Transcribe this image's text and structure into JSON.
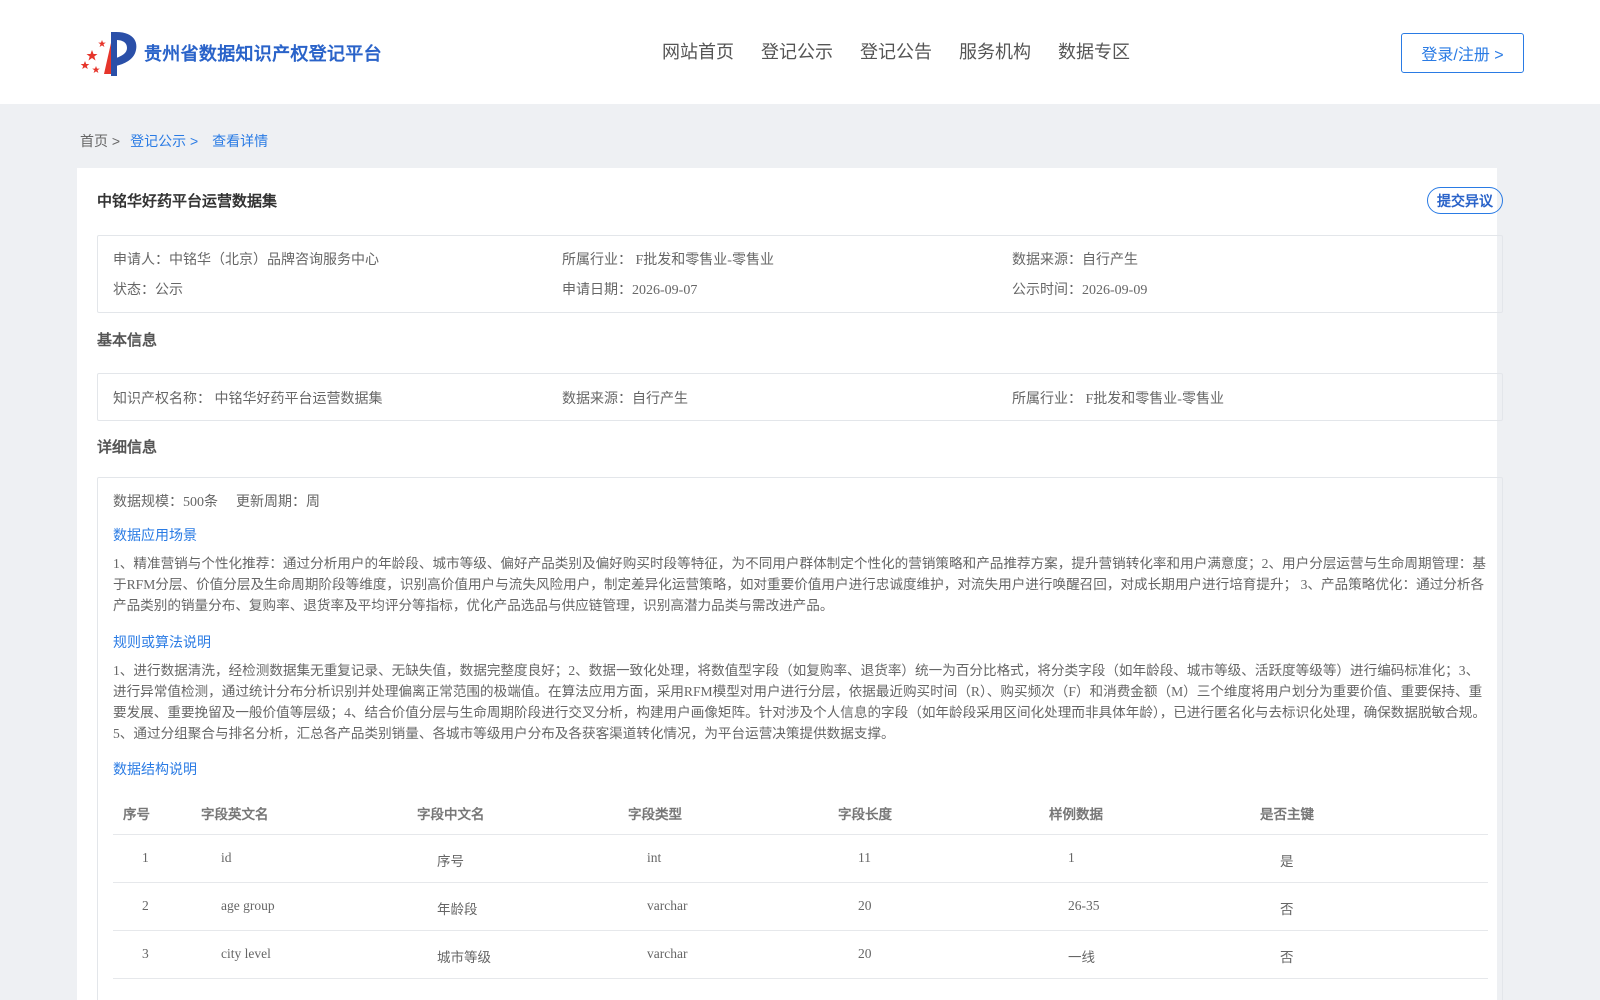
{
  "header": {
    "site_title": "贵州省数据知识产权登记平台",
    "nav": [
      "网站首页",
      "登记公示",
      "登记公告",
      "服务机构",
      "数据专区"
    ],
    "login_label": "登录/注册 >"
  },
  "breadcrumb": {
    "home": "首页 >",
    "section": "登记公示 >",
    "current": "查看详情"
  },
  "detail": {
    "title": "中铭华好药平台运营数据集",
    "objection_label": "提交异议",
    "summary": {
      "applicant": "申请人：中铭华（北京）品牌咨询服务中心",
      "industry": "所属行业： F批发和零售业-零售业",
      "source": "数据来源：自行产生",
      "status": "状态：公示",
      "apply_date": "申请日期：2026-09-07",
      "publish_date": "公示时间：2026-09-09"
    },
    "basic_info_title": "基本信息",
    "basic": {
      "ip_name": "知识产权名称： 中铭华好药平台运营数据集",
      "source": "数据来源：自行产生",
      "industry": "所属行业： F批发和零售业-零售业"
    },
    "detail_info_title": "详细信息",
    "scale": "数据规模：500条",
    "update_cycle": "更新周期：周",
    "scenario_title": "数据应用场景",
    "scenario_text": "1、精准营销与个性化推荐：通过分析用户的年龄段、城市等级、偏好产品类别及偏好购买时段等特征，为不同用户群体制定个性化的营销策略和产品推荐方案，提升营销转化率和用户满意度；2、用户分层运营与生命周期管理：基于RFM分层、价值分层及生命周期阶段等维度，识别高价值用户与流失风险用户，制定差异化运营策略，如对重要价值用户进行忠诚度维护，对流失用户进行唤醒召回，对成长期用户进行培育提升； 3、产品策略优化：通过分析各产品类别的销量分布、复购率、退货率及平均评分等指标，优化产品选品与供应链管理，识别高潜力品类与需改进产品。",
    "rules_title": "规则或算法说明",
    "rules_text": "1、进行数据清洗，经检测数据集无重复记录、无缺失值，数据完整度良好；2、数据一致化处理，将数值型字段（如复购率、退货率）统一为百分比格式，将分类字段（如年龄段、城市等级、活跃度等级等）进行编码标准化；3、进行异常值检测，通过统计分布分析识别并处理偏离正常范围的极端值。在算法应用方面，采用RFM模型对用户进行分层，依据最近购买时间（R）、购买频次（F）和消费金额（M）三个维度将用户划分为重要价值、重要保持、重要发展、重要挽留及一般价值等层级；4、结合价值分层与生命周期阶段进行交叉分析，构建用户画像矩阵。针对涉及个人信息的字段（如年龄段采用区间化处理而非具体年龄），已进行匿名化与去标识化处理，确保数据脱敏合规。5、通过分组聚合与排名分析，汇总各产品类别销量、各城市等级用户分布及各获客渠道转化情况，为平台运营决策提供数据支撑。",
    "structure_title": "数据结构说明",
    "table": {
      "headers": [
        "序号",
        "字段英文名",
        "字段中文名",
        "字段类型",
        "字段长度",
        "样例数据",
        "是否主键"
      ],
      "rows": [
        [
          "1",
          "id",
          "序号",
          "int",
          "11",
          "1",
          "是"
        ],
        [
          "2",
          "age group",
          "年龄段",
          "varchar",
          "20",
          "26-35",
          "否"
        ],
        [
          "3",
          "city level",
          "城市等级",
          "varchar",
          "20",
          "一线",
          "否"
        ]
      ]
    }
  }
}
